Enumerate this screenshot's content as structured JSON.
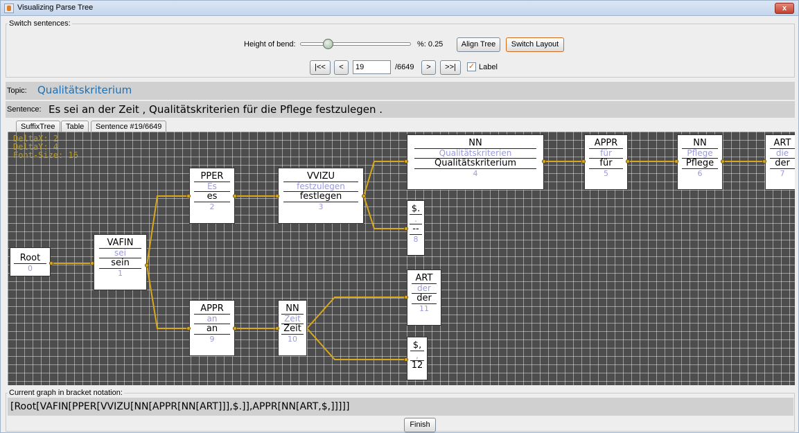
{
  "window": {
    "title": "Visualizing Parse Tree",
    "close_label": "x"
  },
  "switch_panel": {
    "legend": "Switch sentences:",
    "height_of_bend_label": "Height of bend:",
    "slider_value": 0.25,
    "percent_label": "%: 0.25",
    "align_tree": "Align Tree",
    "switch_layout": "Switch Layout",
    "first": "|<<",
    "prev": "<",
    "index": "19",
    "total": "/6649",
    "next": ">",
    "last": ">>|",
    "label_checkbox": "Label",
    "label_checked": true
  },
  "topic": {
    "label": "Topic:",
    "value": "Qualitätskriterium"
  },
  "sentence": {
    "label": "Sentence:",
    "value": "Es sei an der Zeit , Qualitätskriterien für die Pflege festzulegen ."
  },
  "tabs": [
    "SuffixTree",
    "Table",
    "Sentence #19/6649"
  ],
  "overlay": [
    "DeltaX: 2",
    "DeltaY: 4",
    "Font-Size: 16"
  ],
  "nodes": [
    {
      "tag": "Root",
      "word": "",
      "lemma": "",
      "num": "0"
    },
    {
      "tag": "VAFIN",
      "word": "sei",
      "lemma": "sein",
      "num": "1"
    },
    {
      "tag": "PPER",
      "word": "Es",
      "lemma": "es",
      "num": "2"
    },
    {
      "tag": "VVIZU",
      "word": "festzulegen",
      "lemma": "festlegen",
      "num": "3"
    },
    {
      "tag": "NN",
      "word": "Qualitätskriterien",
      "lemma": "Qualitätskriterium",
      "num": "4"
    },
    {
      "tag": "APPR",
      "word": "für",
      "lemma": "für",
      "num": "5"
    },
    {
      "tag": "NN",
      "word": "Pflege",
      "lemma": "Pflege",
      "num": "6"
    },
    {
      "tag": "ART",
      "word": "die",
      "lemma": "der",
      "num": "7"
    },
    {
      "tag": "$.",
      "word": ".",
      "lemma": "--",
      "num": "8"
    },
    {
      "tag": "APPR",
      "word": "an",
      "lemma": "an",
      "num": "9"
    },
    {
      "tag": "NN",
      "word": "Zeit",
      "lemma": "Zeit",
      "num": "10"
    },
    {
      "tag": "ART",
      "word": "der",
      "lemma": "der",
      "num": "11"
    },
    {
      "tag": "$,",
      "word": ",",
      "lemma": "--",
      "num": "12"
    }
  ],
  "bracket": {
    "legend": "Current graph in bracket notation:",
    "value": "[Root[VAFIN[PPER[VVIZU[NN[APPR[NN[ART]]],$.]],APPR[NN[ART,$,]]]]]"
  },
  "finish": "Finish",
  "colors": {
    "canvas_bg": "#4d4d4d",
    "edge": "#d9a81c",
    "word_text": "#9a9adc",
    "topic_text": "#1f6fb3",
    "overlay_text": "#b79d22"
  }
}
